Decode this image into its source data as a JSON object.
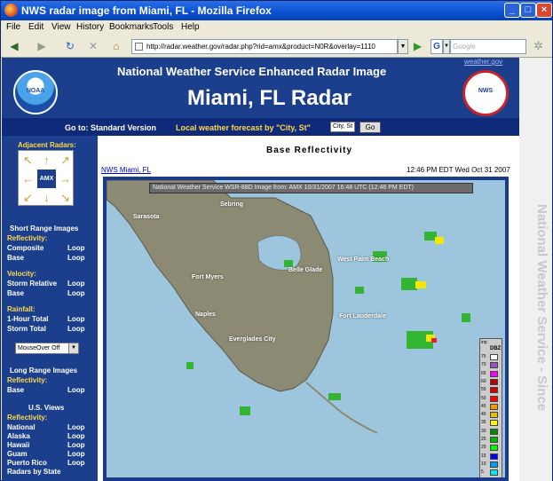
{
  "window": {
    "title": "NWS radar image from Miami, FL - Mozilla Firefox"
  },
  "menu": [
    "File",
    "Edit",
    "View",
    "History",
    "Bookmarks",
    "Tools",
    "Help"
  ],
  "toolbar": {
    "url": "http://radar.weather.gov/radar.php?rid=amx&product=N0R&overlay=1110",
    "search_placeholder": "Google"
  },
  "header": {
    "noaa_logo": "NOAA",
    "title": "National Weather Service Enhanced Radar Image",
    "city": "Miami, FL Radar",
    "weather_link": "weather.gov",
    "nws_logo": "NWS"
  },
  "gobar": {
    "goto": "Go to: Standard Version",
    "local_label": "Local weather forecast by \"City, St\"",
    "city_value": "City, St",
    "go_label": "Go"
  },
  "sidebar": {
    "adjacent_heading": "Adjacent Radars:",
    "center_code": "AMX",
    "short_range_title": "Short Range Images",
    "reflectivity": "Reflectivity:",
    "composite": "Composite",
    "base": "Base",
    "loop": "Loop",
    "velocity": "Velocity:",
    "storm_relative": "Storm Relative",
    "rainfall": "Rainfall:",
    "one_hour_total": "1-Hour Total",
    "storm_total": "Storm Total",
    "mouseover": "MouseOver Off",
    "long_range_title": "Long Range Images",
    "us_views_title": "U.S. Views",
    "national": "National",
    "alaska": "Alaska",
    "hawaii": "Hawaii",
    "guam": "Guam",
    "puerto_rico": "Puerto Rico",
    "radars_by_state": "Radars by State"
  },
  "content": {
    "base_reflectivity": "Base Reflectivity",
    "office_link": "NWS Miami, FL",
    "timestamp": "12:46 PM EDT Wed Oct 31 2007",
    "banner": "National Weather Service WSR-88D Image from: AMX 10/31/2007 16:48 UTC (12:46 PM EDT)",
    "cities": [
      "Sebring",
      "Sarasota",
      "Fort Myers",
      "Naples",
      "Belle Glade",
      "West Palm Beach",
      "Everglades City",
      "Fort Lauderdale"
    ],
    "legend_header": "inp",
    "legend_unit": "DBZ",
    "legend_values": [
      "75",
      "70",
      "65",
      "60",
      "55",
      "50",
      "45",
      "40",
      "35",
      "30",
      "25",
      "20",
      "15",
      "10",
      "5"
    ],
    "legend_colors": [
      "#ffffff",
      "#9854c6",
      "#f800fd",
      "#bc0000",
      "#d40000",
      "#fd0000",
      "#fd9500",
      "#e5bc00",
      "#fdf802",
      "#008e00",
      "#01b501",
      "#02fd02",
      "#0300f4",
      "#019ff4",
      "#04e9e7"
    ]
  },
  "side_text": "National Weather Service - Since"
}
